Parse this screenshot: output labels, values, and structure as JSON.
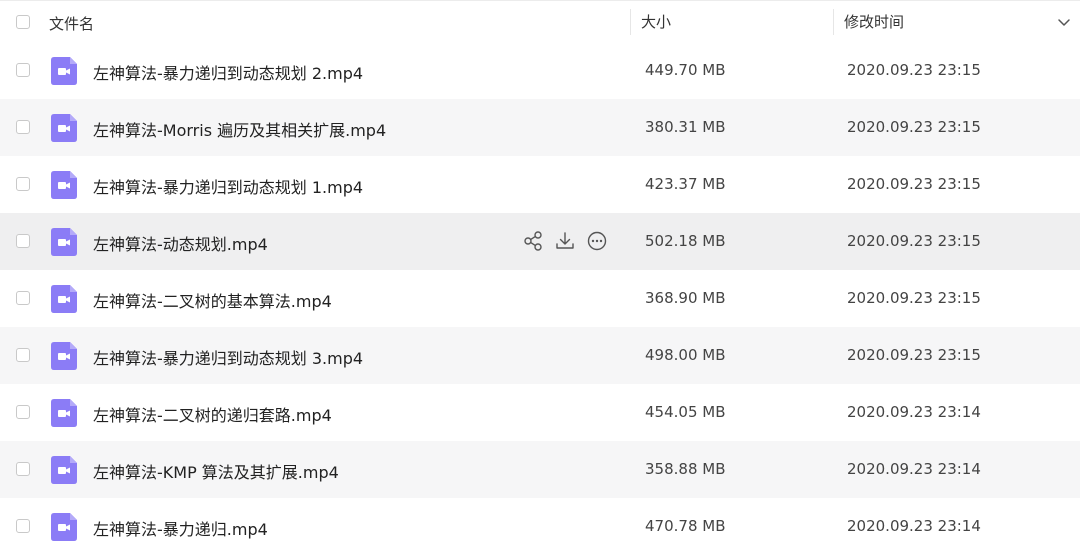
{
  "header": {
    "name_label": "文件名",
    "size_label": "大小",
    "time_label": "修改时间"
  },
  "colors": {
    "icon_purple": "#8b7cf6",
    "row_alt": "#f6f6f7",
    "row_hover": "#efeff0"
  },
  "files": [
    {
      "name": "左神算法-暴力递归到动态规划 2.mp4",
      "size": "449.70 MB",
      "time": "2020.09.23 23:15"
    },
    {
      "name": "左神算法-Morris 遍历及其相关扩展.mp4",
      "size": "380.31 MB",
      "time": "2020.09.23 23:15"
    },
    {
      "name": "左神算法-暴力递归到动态规划 1.mp4",
      "size": "423.37 MB",
      "time": "2020.09.23 23:15"
    },
    {
      "name": "左神算法-动态规划.mp4",
      "size": "502.18 MB",
      "time": "2020.09.23 23:15"
    },
    {
      "name": "左神算法-二叉树的基本算法.mp4",
      "size": "368.90 MB",
      "time": "2020.09.23 23:15"
    },
    {
      "name": "左神算法-暴力递归到动态规划 3.mp4",
      "size": "498.00 MB",
      "time": "2020.09.23 23:15"
    },
    {
      "name": "左神算法-二叉树的递归套路.mp4",
      "size": "454.05 MB",
      "time": "2020.09.23 23:14"
    },
    {
      "name": "左神算法-KMP 算法及其扩展.mp4",
      "size": "358.88 MB",
      "time": "2020.09.23 23:14"
    },
    {
      "name": "左神算法-暴力递归.mp4",
      "size": "470.78 MB",
      "time": "2020.09.23 23:14"
    }
  ],
  "row_actions": {
    "icons": [
      "share-icon",
      "download-icon",
      "more-icon"
    ]
  }
}
